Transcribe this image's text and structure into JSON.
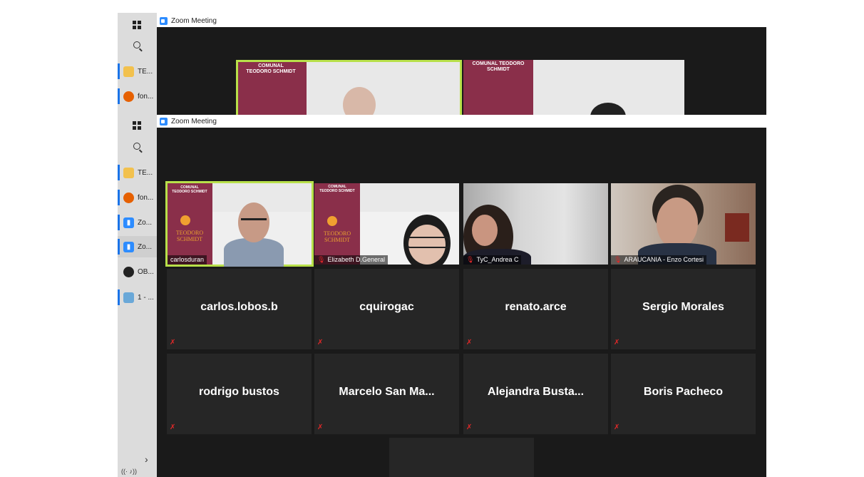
{
  "top_window": {
    "title": "Zoom Meeting",
    "tiles": [
      {
        "banner": "COMUNAL TEODORO SCHMIDT"
      },
      {
        "banner": "COMUNAL TEODORO SCHMIDT"
      }
    ]
  },
  "window": {
    "title": "Zoom Meeting"
  },
  "taskbar_top": {
    "items": [
      {
        "label": "TE...",
        "icon": "folder-icon"
      },
      {
        "label": "fon...",
        "icon": "firefox-icon"
      }
    ]
  },
  "taskbar": {
    "items": [
      {
        "label": "TE...",
        "icon": "folder-icon"
      },
      {
        "label": "fon...",
        "icon": "firefox-icon"
      },
      {
        "label": "Zo...",
        "icon": "zoom-icon"
      },
      {
        "label": "Zo...",
        "icon": "zoom-icon"
      },
      {
        "label": "OB...",
        "icon": "obs-icon"
      },
      {
        "label": "1 - ...",
        "icon": "paint-icon"
      }
    ],
    "chevron": "›",
    "tray": "((·  ♪))"
  },
  "participants_video": [
    {
      "name": "carlosduran",
      "muted": false,
      "speaking": true,
      "banner": "COMUNAL TEODORO SCHMIDT",
      "logo": "TEODORO SCHMIDT"
    },
    {
      "name": "Elizabeth D.General",
      "muted": true,
      "banner": "COMUNAL TEODORO SCHMIDT",
      "logo": "TEODORO SCHMIDT"
    },
    {
      "name": "TyC_Andrea C",
      "muted": true
    },
    {
      "name": "ARAUCANIA - Enzo Cortesi",
      "muted": true
    }
  ],
  "participants_audio": [
    {
      "name": "carlos.lobos.b"
    },
    {
      "name": "cquirogac"
    },
    {
      "name": "renato.arce"
    },
    {
      "name": "Sergio Morales"
    },
    {
      "name": "rodrigo bustos"
    },
    {
      "name": "Marcelo San Ma..."
    },
    {
      "name": "Alejandra Busta..."
    },
    {
      "name": "Boris Pacheco"
    }
  ],
  "colors": {
    "accent_speaker": "#b8e04a",
    "zoom_blue": "#2d8cff",
    "muted_red": "#e02828",
    "banner_maroon": "#8a2f4a",
    "meeting_bg": "#1a1a1a",
    "tile_bg": "#262626"
  }
}
